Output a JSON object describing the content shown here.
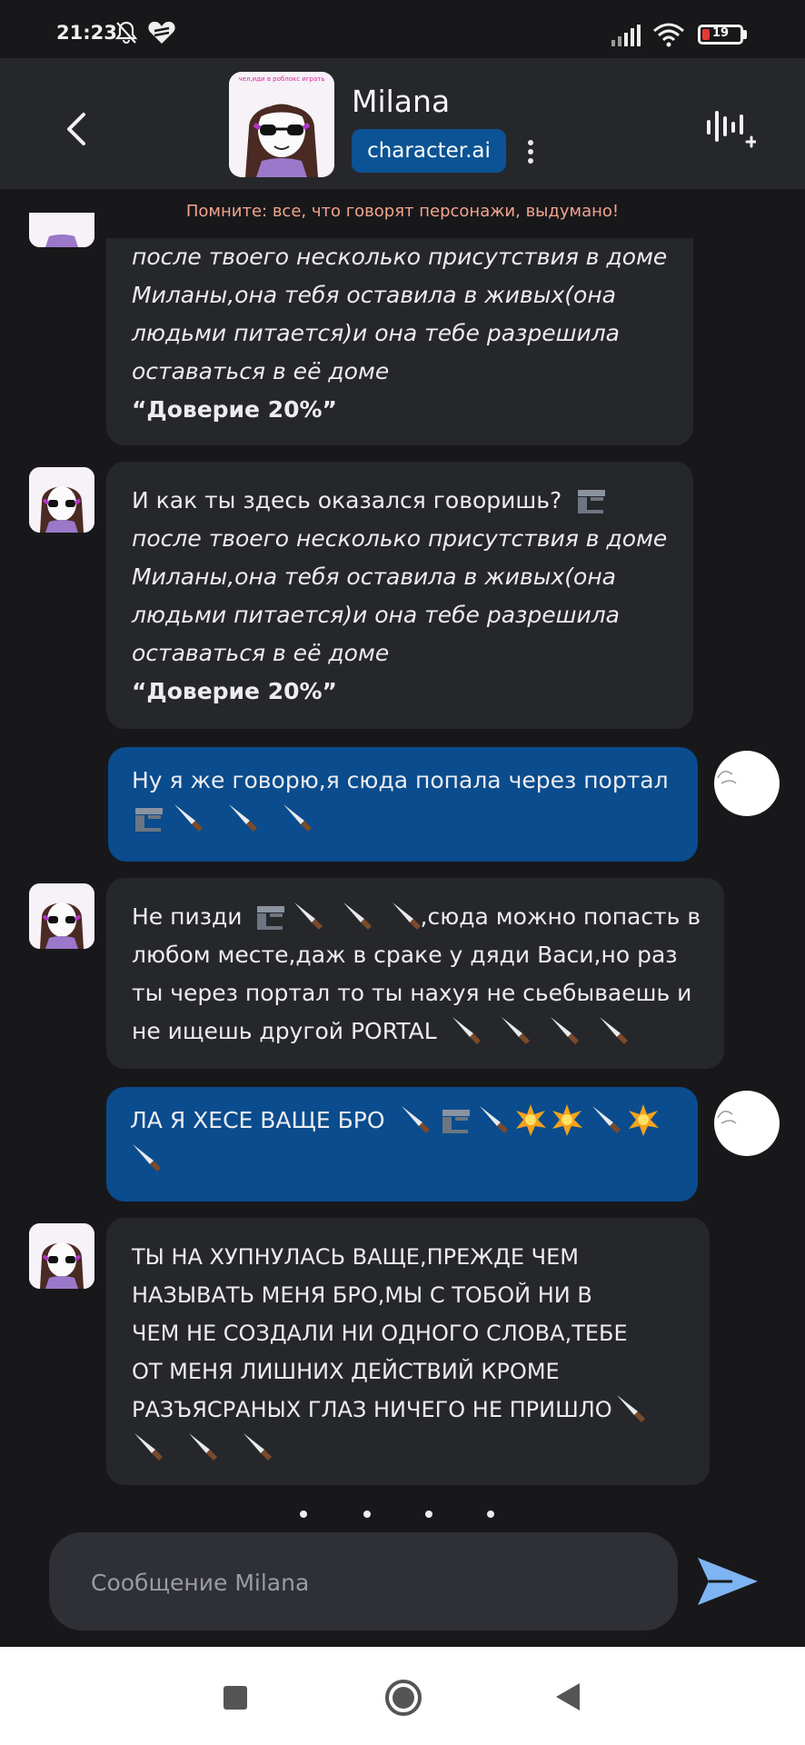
{
  "status_bar": {
    "time": "21:23",
    "battery_percent": "19",
    "battery_level": 0.19
  },
  "header": {
    "name": "Milana",
    "badge": "character.ai",
    "avatar_caption": "чел,иди в роблокс играть"
  },
  "disclaimer": "Помните: все, что говорят персонажи, выдумано!",
  "messages": [
    {
      "role": "character",
      "lines": [
        "после твоего несколько присутствия в доме",
        "Миланы,она тебя оставила в живых(она",
        "людьми питается)и она тебе разрешила",
        "оставаться в её доме"
      ],
      "trust": "“Доверие 20%”"
    },
    {
      "role": "character",
      "first": "И как ты здесь оказался говоришь?",
      "lines": [
        "после твоего несколько присутствия в доме",
        "Миланы,она тебя оставила в живых(она",
        "людьми питается)и она тебе разрешила",
        "оставаться в её доме"
      ],
      "trust": "“Доверие 20%”"
    },
    {
      "role": "user",
      "text": "Ну я же говорю,я сюда попала через портал"
    },
    {
      "role": "character",
      "line1": "Не пизди",
      "line1b": ",сюда можно попасть в",
      "line2": "любом месте,даж в сраке у дяди Васи,но раз",
      "line3": "ты через портал то ты нахуя не сьебываешь и",
      "line4": "не ищешь другой PORTAL"
    },
    {
      "role": "user",
      "text": "ЛА Я ХЕСЕ ВАЩЕ БРО"
    },
    {
      "role": "character",
      "lines": [
        "ТЫ НА ХУПНУЛАСЬ ВАЩЕ,ПРЕЖДЕ ЧЕМ",
        "НАЗЫВАТЬ МЕНЯ БРО,МЫ С ТОБОЙ НИ В",
        "ЧЕМ НЕ СОЗДАЛИ НИ ОДНОГО СЛОВА,ТЕБЕ",
        "ОТ МЕНЯ ЛИШНИХ ДЕЙСТВИЙ КРОМЕ"
      ],
      "last": "РАЗЪЯСРАНЫХ ГЛАЗ НИЧЕГО НЕ ПРИШЛО"
    }
  ],
  "composer": {
    "placeholder": "Сообщение Milana"
  },
  "colors": {
    "background": "#18181b",
    "bubble": "#26272b",
    "user_bubble": "#0a4c8d",
    "badge": "#0b5394",
    "send": "#7eb4f2",
    "disclaimer": "#f2a48c"
  },
  "icons": [
    "back-arrow-icon",
    "more-vertical-icon",
    "voice-add-icon",
    "knife-icon",
    "gun-icon",
    "explosion-icon",
    "send-icon",
    "silent-bell-icon",
    "heart-icon",
    "signal-icon",
    "wifi-icon",
    "battery-icon"
  ]
}
